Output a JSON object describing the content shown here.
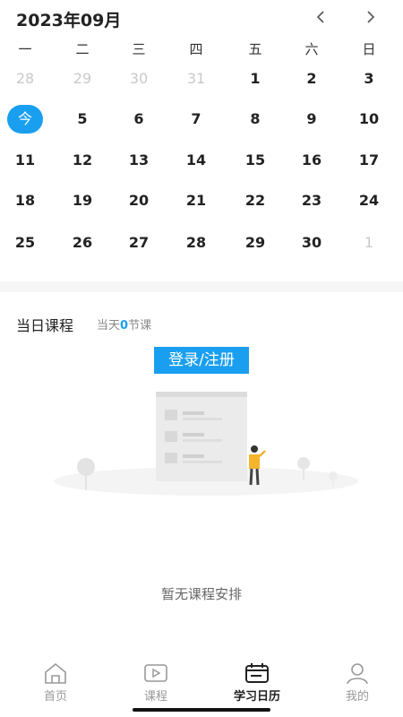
{
  "header": {
    "month_title": "2023年09月"
  },
  "weekdays": [
    "一",
    "二",
    "三",
    "四",
    "五",
    "六",
    "日"
  ],
  "calendar": {
    "weeks": [
      [
        {
          "d": "28",
          "dim": true
        },
        {
          "d": "29",
          "dim": true
        },
        {
          "d": "30",
          "dim": true
        },
        {
          "d": "31",
          "dim": true
        },
        {
          "d": "1"
        },
        {
          "d": "2"
        },
        {
          "d": "3"
        }
      ],
      [
        {
          "d": "今",
          "today": true
        },
        {
          "d": "5"
        },
        {
          "d": "6"
        },
        {
          "d": "7"
        },
        {
          "d": "8"
        },
        {
          "d": "9"
        },
        {
          "d": "10"
        }
      ],
      [
        {
          "d": "11"
        },
        {
          "d": "12"
        },
        {
          "d": "13"
        },
        {
          "d": "14"
        },
        {
          "d": "15"
        },
        {
          "d": "16"
        },
        {
          "d": "17"
        }
      ],
      [
        {
          "d": "18"
        },
        {
          "d": "19"
        },
        {
          "d": "20"
        },
        {
          "d": "21"
        },
        {
          "d": "22"
        },
        {
          "d": "23"
        },
        {
          "d": "24"
        }
      ],
      [
        {
          "d": "25"
        },
        {
          "d": "26"
        },
        {
          "d": "27"
        },
        {
          "d": "28"
        },
        {
          "d": "29"
        },
        {
          "d": "30"
        },
        {
          "d": "1",
          "dim": true
        }
      ]
    ]
  },
  "section": {
    "title": "当日课程",
    "count_prefix": "当天",
    "count_value": "0",
    "count_suffix": "节课"
  },
  "login_button": "登录/注册",
  "empty_text": "暂无课程安排",
  "tabbar": {
    "items": [
      {
        "label": "首页",
        "icon": "home-icon"
      },
      {
        "label": "课程",
        "icon": "play-icon"
      },
      {
        "label": "学习日历",
        "icon": "calendar-icon",
        "active": true
      },
      {
        "label": "我的",
        "icon": "user-icon"
      }
    ]
  },
  "colors": {
    "accent": "#1a9ff0"
  }
}
